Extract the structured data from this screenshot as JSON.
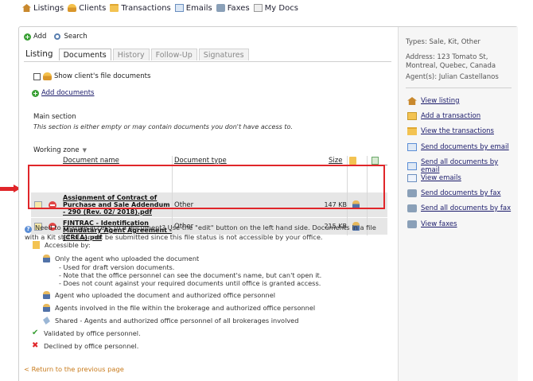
{
  "topnav": {
    "items": [
      {
        "label": "Listings",
        "icon": "house-icon"
      },
      {
        "label": "Clients",
        "icon": "person-icon"
      },
      {
        "label": "Transactions",
        "icon": "folder-icon"
      },
      {
        "label": "Emails",
        "icon": "envelope-icon"
      },
      {
        "label": "Faxes",
        "icon": "fax-icon"
      },
      {
        "label": "My Docs",
        "icon": "documents-icon"
      }
    ]
  },
  "actions": {
    "add": "Add",
    "search": "Search"
  },
  "tabs": {
    "listing": "Listing",
    "documents": "Documents",
    "history": "History",
    "followup": "Follow-Up",
    "signatures": "Signatures"
  },
  "documents": {
    "show_client_docs": "Show client's file documents",
    "add_documents": "Add documents",
    "main_section_title": "Main section",
    "main_section_note": "This section is either empty or may contain documents you don't have access to.",
    "working_zone": "Working zone",
    "table": {
      "headers": {
        "name": "Document name",
        "type": "Document type",
        "size": "Size"
      },
      "rows": [
        {
          "name": "Assignment of Contract of Purchase and Sale Addendum - 290 (Rev. 02/ 2018).pdf",
          "type": "Other",
          "size": "147 KB"
        },
        {
          "name": "FINTRAC - Identification Mandatary Agent Agreement - (CREA).pdf",
          "type": "Other",
          "size": "215 KB"
        }
      ]
    }
  },
  "info": {
    "access_text": "Need to change access to a document? Use the \"edit\" button on the left hand side. Documents in a file with a Kit status cannot be submitted since this file status is not accessible by your office.",
    "accessible_by": "Accessible by:",
    "only_agent": "Only the agent who uploaded the document",
    "notes": [
      "- Used for draft version documents.",
      "- Note that the office personnel can see the document's name, but can't open it.",
      "- Does not count against your required documents until office is granted access."
    ],
    "agent_and_office": "Agent who uploaded the document and authorized office personnel",
    "agents_involved": "Agents involved in the file within the brokerage and authorized office personnel",
    "shared": "Shared - Agents and authorized office personnel of all brokerages involved",
    "validated": "Validated by office personnel.",
    "declined": "Declined by office personnel.",
    "return": "< Return to the previous page"
  },
  "sidebar": {
    "types": "Types: Sale, Kit, Other",
    "address": "Address: 123 Tomato St, Montreal, Quebec, Canada",
    "agents": "Agent(s): Julian Castellanos",
    "links": [
      {
        "label": "View listing",
        "icon": "house-icon"
      },
      {
        "label": "Add a transaction",
        "icon": "add-transaction-icon"
      },
      {
        "label": "View the transactions",
        "icon": "folder-icon"
      },
      {
        "label": "Send documents by email",
        "icon": "send-email-icon"
      },
      {
        "label": "Send all documents by email",
        "icon": "send-email-icon"
      },
      {
        "label": "View emails",
        "icon": "email-icon"
      },
      {
        "label": "Send documents by fax",
        "icon": "fax-icon"
      },
      {
        "label": "Send all documents by fax",
        "icon": "fax-icon"
      },
      {
        "label": "View faxes",
        "icon": "fax-icon"
      }
    ]
  },
  "colors": {
    "highlight": "#e0262a",
    "link": "#1a1a6a",
    "return_link": "#c87a1a"
  }
}
